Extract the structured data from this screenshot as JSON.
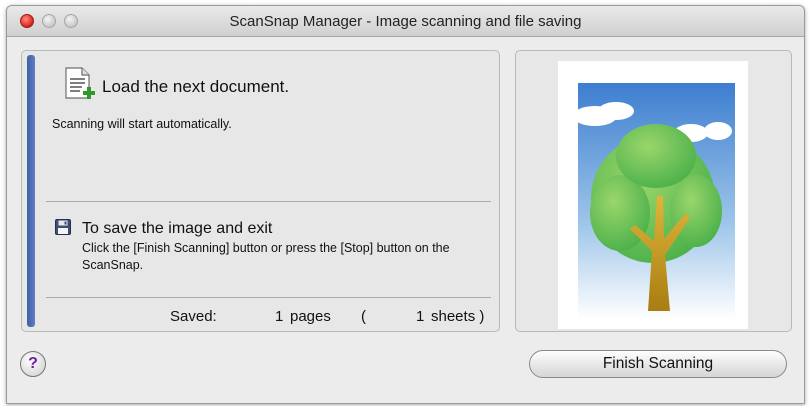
{
  "window": {
    "title": "ScanSnap Manager - Image scanning and file saving"
  },
  "load": {
    "title": "Load the next document.",
    "subtitle": "Scanning will start automatically."
  },
  "save": {
    "title": "To save the image and exit",
    "description": "Click the [Finish Scanning] button or press the [Stop] button on the ScanSnap."
  },
  "status": {
    "saved_label": "Saved:",
    "pages_count": "1",
    "pages_unit": "pages",
    "open_paren": "(",
    "sheets_count": "1",
    "sheets_unit": "sheets )"
  },
  "buttons": {
    "help": "?",
    "finish": "Finish Scanning"
  },
  "preview": {
    "subject": "tree-illustration",
    "colors": {
      "sky": "#3d7ed0",
      "tree": "#5fbf48",
      "trunk": "#b98a14"
    }
  },
  "icons": [
    "document-add-icon",
    "floppy-disk-icon",
    "help-icon"
  ]
}
